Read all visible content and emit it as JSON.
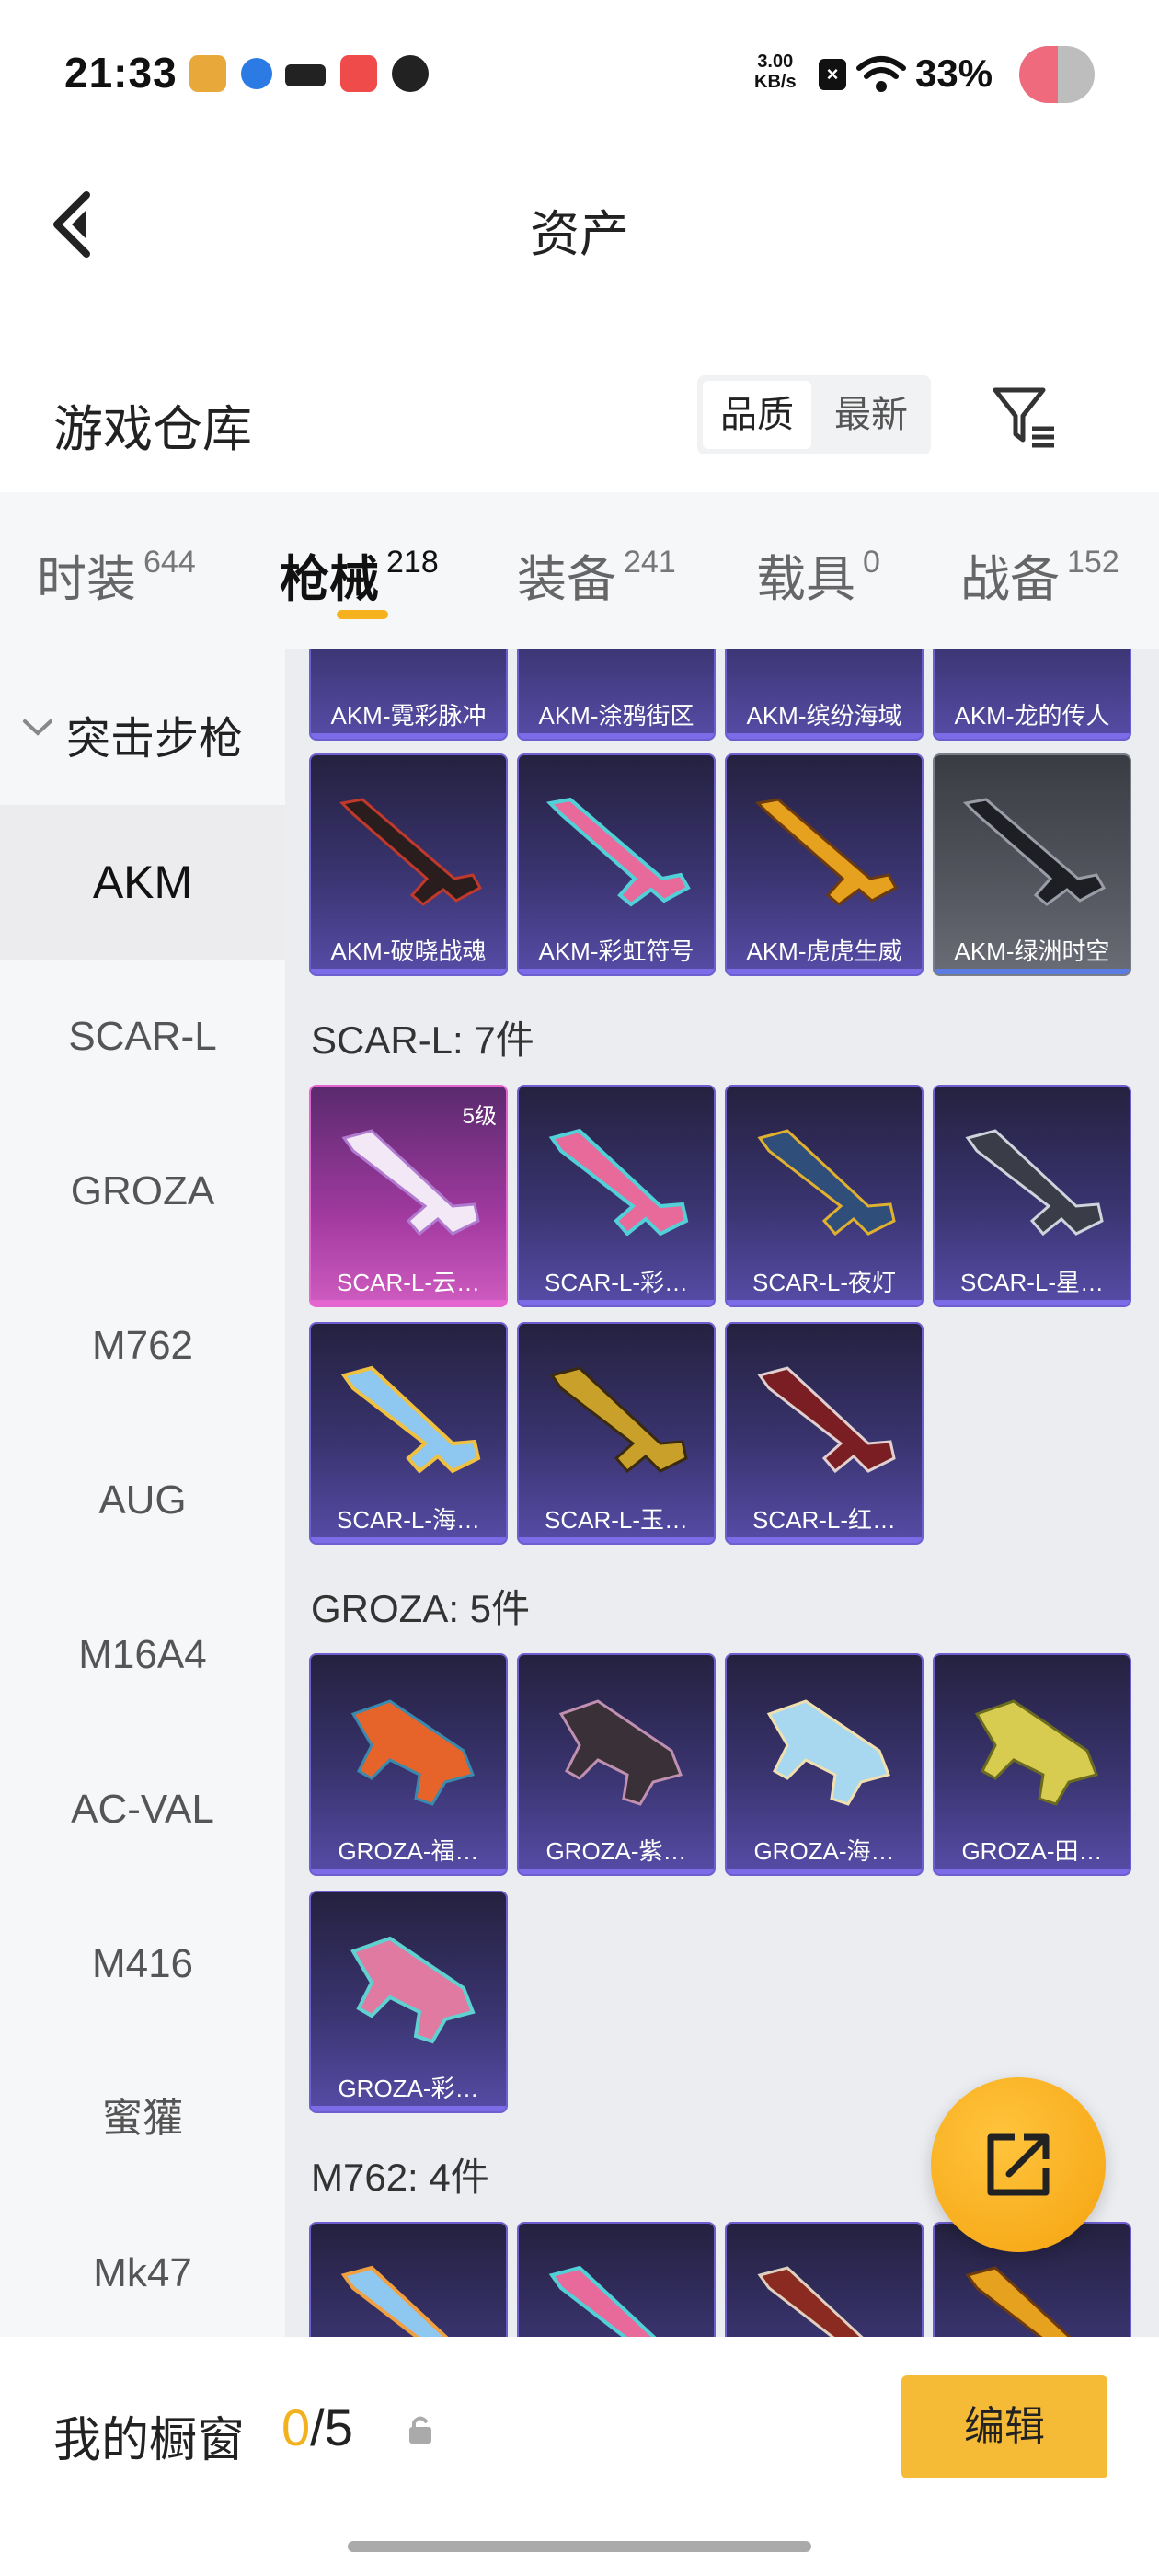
{
  "status_bar": {
    "time": "21:33",
    "net_speed_value": "3.00",
    "net_speed_unit": "KB/s",
    "battery": "33%"
  },
  "header": {
    "title": "资产",
    "back_icon": "chevron-left-icon"
  },
  "warehouse": {
    "title": "游戏仓库",
    "sort_options": [
      "品质",
      "最新"
    ],
    "active_sort": "品质",
    "filter_icon": "filter-icon"
  },
  "tabs": [
    {
      "label": "时装",
      "count": "644"
    },
    {
      "label": "枪械",
      "count": "218"
    },
    {
      "label": "装备",
      "count": "241"
    },
    {
      "label": "载具",
      "count": "0"
    },
    {
      "label": "战备",
      "count": "152"
    }
  ],
  "active_tab": "枪械",
  "sidebar": {
    "category": "突击步枪",
    "items": [
      "AKM",
      "SCAR-L",
      "GROZA",
      "M762",
      "AUG",
      "M16A4",
      "AC-VAL",
      "M416",
      "蜜獾",
      "Mk47"
    ],
    "active": "AKM"
  },
  "sections": [
    {
      "title": "",
      "items": [
        {
          "name": "AKM-霓彩脉冲"
        },
        {
          "name": "AKM-涂鸦街区"
        },
        {
          "name": "AKM-缤纷海域"
        },
        {
          "name": "AKM-龙的传人"
        },
        {
          "name": "AKM-破晓战魂"
        },
        {
          "name": "AKM-彩虹符号"
        },
        {
          "name": "AKM-虎虎生威"
        },
        {
          "name": "AKM-绿洲时空"
        }
      ]
    },
    {
      "title": "SCAR-L: 7件",
      "items": [
        {
          "name": "SCAR-L-云…",
          "badge": "5级"
        },
        {
          "name": "SCAR-L-彩…"
        },
        {
          "name": "SCAR-L-夜灯"
        },
        {
          "name": "SCAR-L-星…"
        },
        {
          "name": "SCAR-L-海…"
        },
        {
          "name": "SCAR-L-玉…"
        },
        {
          "name": "SCAR-L-红…"
        }
      ]
    },
    {
      "title": "GROZA: 5件",
      "items": [
        {
          "name": "GROZA-福…"
        },
        {
          "name": "GROZA-紫…"
        },
        {
          "name": "GROZA-海…"
        },
        {
          "name": "GROZA-田…"
        },
        {
          "name": "GROZA-彩…"
        }
      ]
    },
    {
      "title": "M762: 4件",
      "items": [
        {
          "name": ""
        },
        {
          "name": ""
        },
        {
          "name": ""
        },
        {
          "name": ""
        }
      ]
    }
  ],
  "fab_icon": "share-icon",
  "bottom_bar": {
    "title": "我的橱窗",
    "count_current": "0",
    "count_sep": "/",
    "count_total": "5",
    "lock_icon": "lock-icon",
    "edit_label": "编辑"
  },
  "colors": {
    "accent": "#f5b21e",
    "card_purple": "#574ca7",
    "card_border": "#6d5fd0",
    "card_pink": "#d05cc0"
  }
}
